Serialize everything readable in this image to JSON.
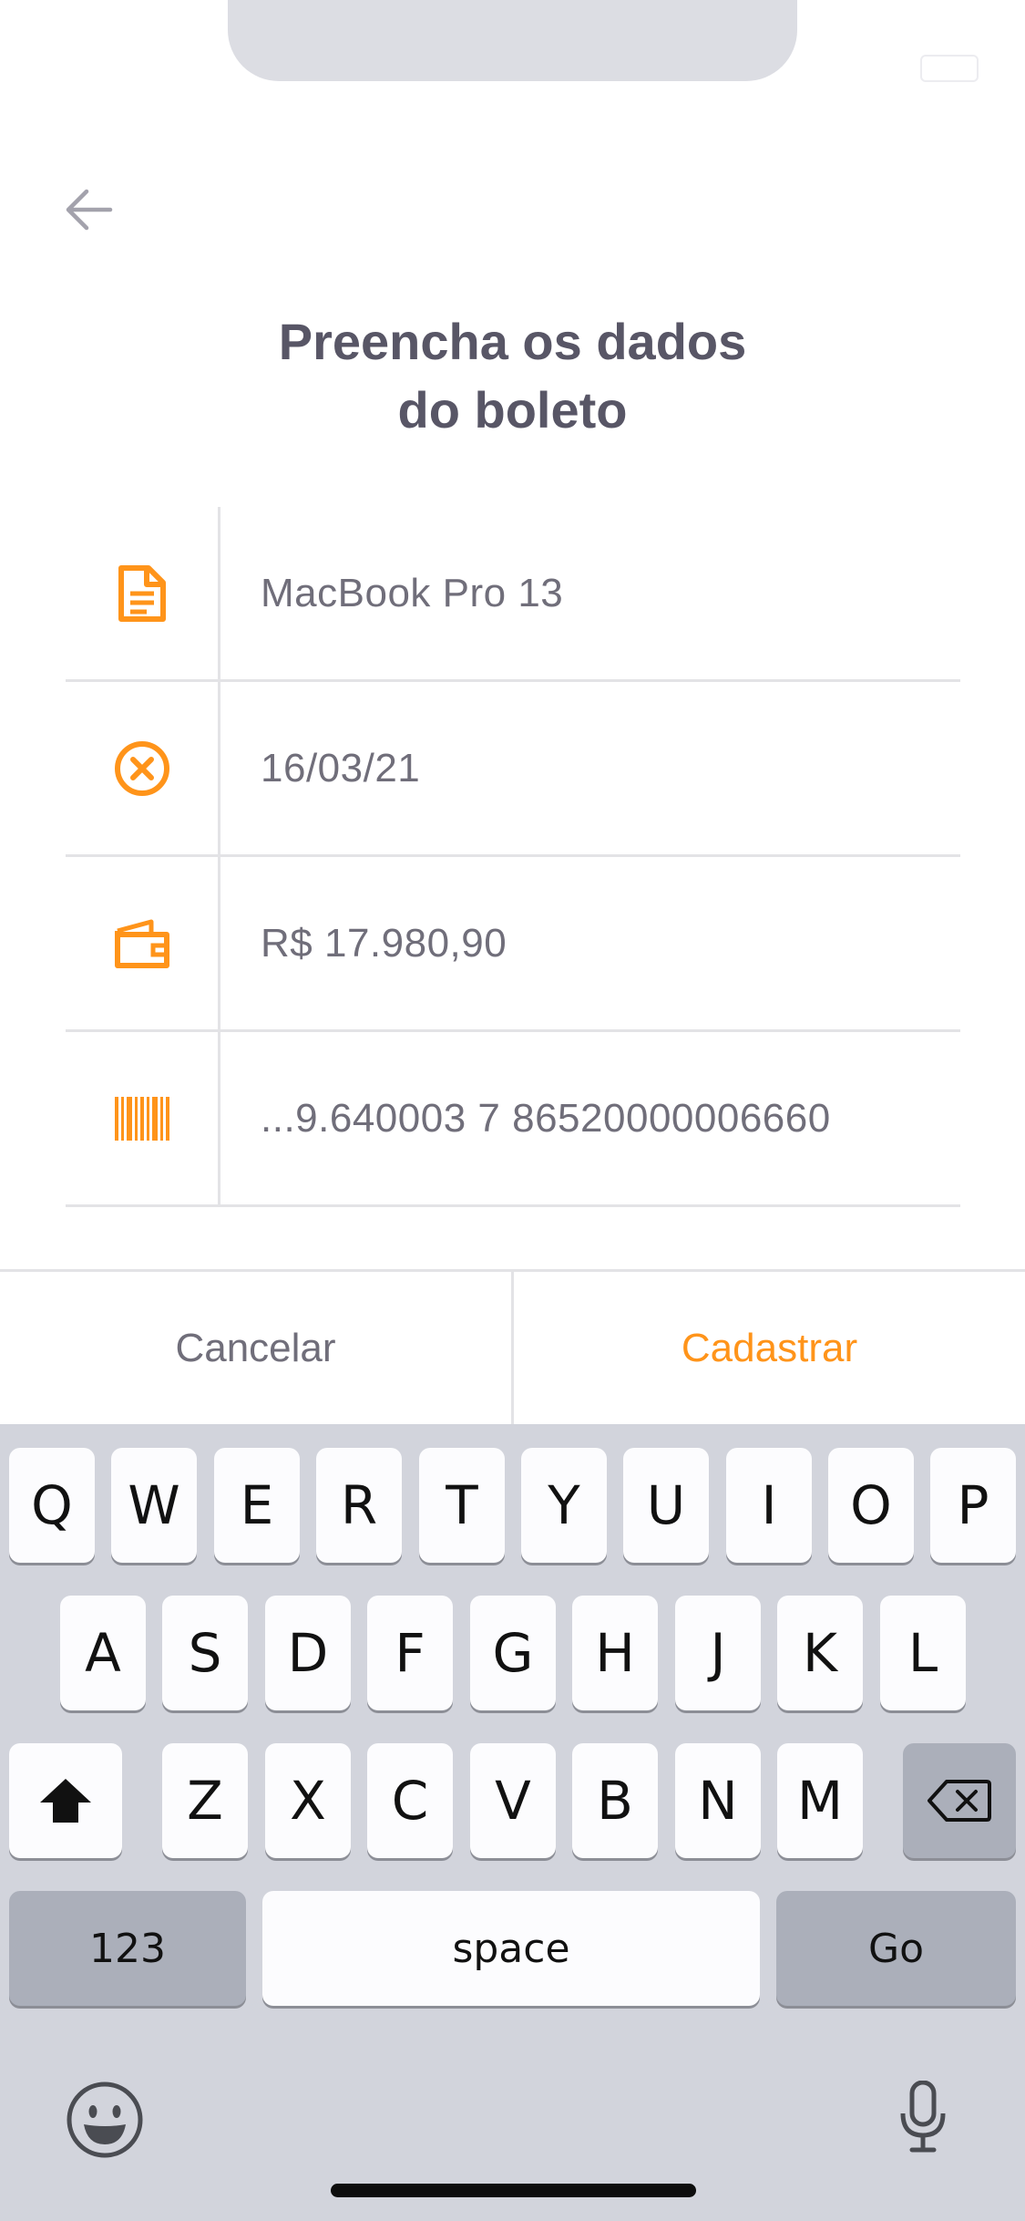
{
  "header": {
    "back_icon": "arrow-left-icon",
    "title": "Preencha os dados\ndo boleto"
  },
  "form": {
    "fields": [
      {
        "icon": "document-icon",
        "value": "MacBook Pro 13"
      },
      {
        "icon": "x-circle-icon",
        "value": "16/03/21"
      },
      {
        "icon": "wallet-icon",
        "value": "R$ 17.980,90"
      },
      {
        "icon": "barcode-icon",
        "value": "...9.640003 7 86520000006660"
      }
    ]
  },
  "actions": {
    "cancel_label": "Cancelar",
    "submit_label": "Cadastrar"
  },
  "keyboard": {
    "row1": [
      "Q",
      "W",
      "E",
      "R",
      "T",
      "Y",
      "U",
      "I",
      "O",
      "P"
    ],
    "row2": [
      "A",
      "S",
      "D",
      "F",
      "G",
      "H",
      "J",
      "K",
      "L"
    ],
    "row3": [
      "Z",
      "X",
      "C",
      "V",
      "B",
      "N",
      "M"
    ],
    "numbers_label": "123",
    "space_label": "space",
    "go_label": "Go",
    "shift_icon": "shift-icon",
    "backspace_icon": "backspace-icon",
    "emoji_icon": "emoji-icon",
    "mic_icon": "microphone-icon"
  },
  "colors": {
    "accent": "#FF941A",
    "heading": "#585666",
    "body_text": "#706E7A",
    "keyboard_bg": "#D2D4DC"
  }
}
